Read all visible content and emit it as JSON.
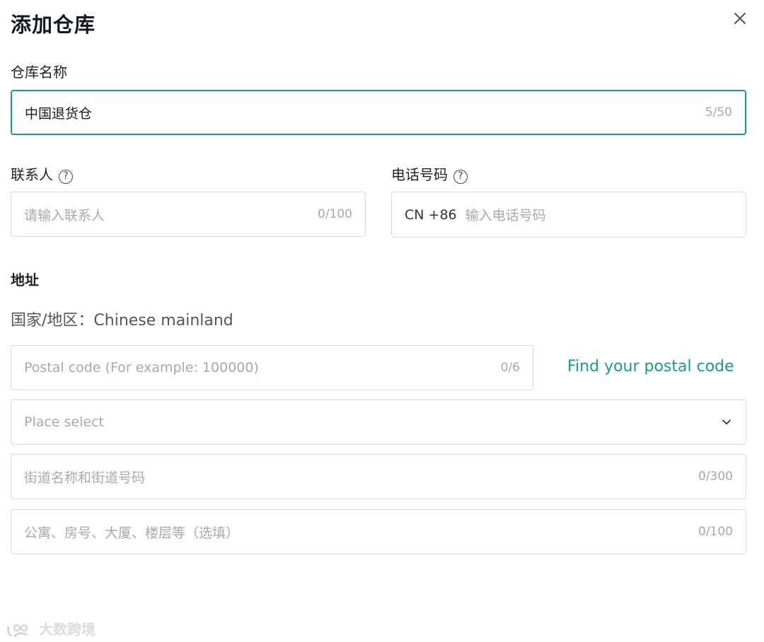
{
  "dialog": {
    "title": "添加仓库"
  },
  "warehouse_name": {
    "label": "仓库名称",
    "value": "中国退货仓",
    "count": "5/50"
  },
  "contact": {
    "label": "联系人",
    "placeholder": "请输入联系人",
    "count": "0/100"
  },
  "phone": {
    "label": "电话号码",
    "country_code": "CN +86",
    "placeholder": "输入电话号码"
  },
  "address": {
    "label": "地址",
    "region": "国家/地区：Chinese mainland",
    "postal": {
      "placeholder": "Postal code (For example: 100000)",
      "count": "0/6"
    },
    "find_postal_link": "Find your postal code",
    "select": {
      "placeholder": "Place select"
    },
    "street": {
      "placeholder": "街道名称和街道号码",
      "count": "0/300"
    },
    "detail": {
      "placeholder": "公寓、房号、大厦、楼层等（选填）",
      "count": "0/100"
    }
  },
  "help_glyph": "?",
  "watermark": "大数跨境",
  "colors": {
    "accent": "#1c9a8c",
    "border": "#d9d9db",
    "placeholder": "#a8a8ad"
  }
}
